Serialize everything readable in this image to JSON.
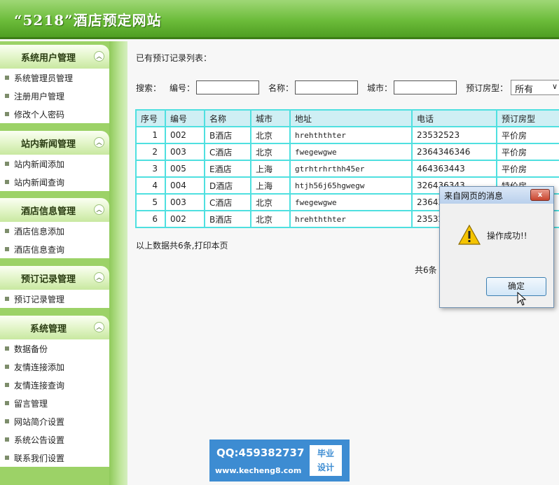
{
  "header": {
    "title": "“5218”酒店预定网站"
  },
  "sidebar": {
    "groups": [
      {
        "title": "系统用户管理",
        "items": [
          "系统管理员管理",
          "注册用户管理",
          "修改个人密码"
        ]
      },
      {
        "title": "站内新闻管理",
        "items": [
          "站内新闻添加",
          "站内新闻查询"
        ]
      },
      {
        "title": "酒店信息管理",
        "items": [
          "酒店信息添加",
          "酒店信息查询"
        ]
      },
      {
        "title": "预订记录管理",
        "items": [
          "预订记录管理"
        ]
      },
      {
        "title": "系统管理",
        "items": [
          "数据备份",
          "友情连接添加",
          "友情连接查询",
          "留言管理",
          "网站简介设置",
          "系统公告设置",
          "联系我们设置"
        ]
      }
    ]
  },
  "main": {
    "section_title": "已有预订记录列表：",
    "search": {
      "label": "搜索：",
      "code_label": "编号：",
      "name_label": "名称：",
      "city_label": "城市：",
      "room_label": "预订房型：",
      "room_selected": "所有"
    },
    "table": {
      "headers": [
        "序号",
        "编号",
        "名称",
        "城市",
        "地址",
        "电话",
        "预订房型"
      ],
      "rows": [
        [
          "1",
          "002",
          "B酒店",
          "北京",
          "hrehththter",
          "23532523",
          "平价房"
        ],
        [
          "2",
          "003",
          "C酒店",
          "北京",
          "fwegewgwe",
          "2364346346",
          "平价房"
        ],
        [
          "3",
          "005",
          "E酒店",
          "上海",
          "gtrhtrhrthh45er",
          "464363443",
          "平价房"
        ],
        [
          "4",
          "004",
          "D酒店",
          "上海",
          "htjh56j65hgwegw",
          "326436343",
          "特价房"
        ],
        [
          "5",
          "003",
          "C酒店",
          "北京",
          "fwegewgwe",
          "23643",
          ""
        ],
        [
          "6",
          "002",
          "B酒店",
          "北京",
          "hrehththter",
          "23532",
          ""
        ]
      ]
    },
    "summary": "以上数据共6条,打印本页",
    "pager": "共6条"
  },
  "dialog": {
    "title": "来自网页的消息",
    "message": "操作成功!!",
    "ok_label": "确定",
    "close_symbol": "x"
  },
  "badge": {
    "qq": "QQ:459382737",
    "url": "www.kecheng8.com",
    "tag_line1": "毕业",
    "tag_line2": "设计"
  },
  "colors": {
    "header_green": "#6cbc3a",
    "sidebar_green": "#9cd267",
    "table_border_cyan": "#4fe0e0",
    "table_header_bg": "#cfeff4",
    "badge_blue": "#3d8cd2"
  }
}
